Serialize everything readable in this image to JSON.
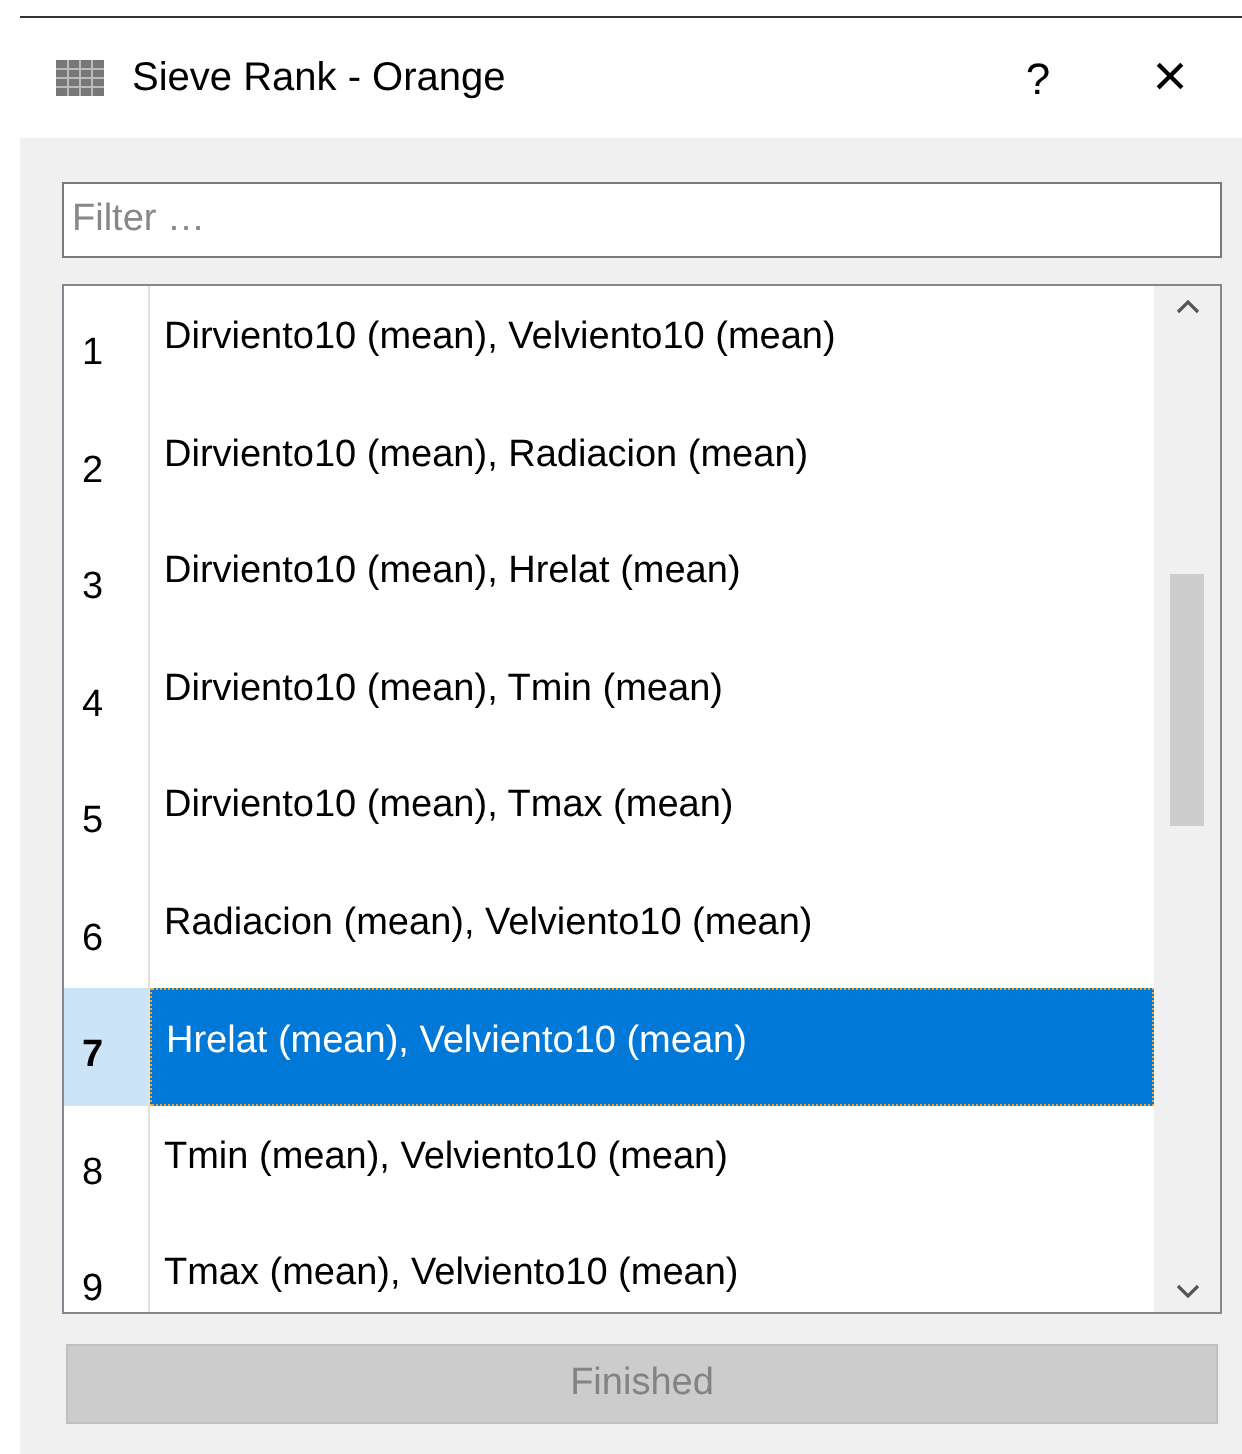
{
  "window": {
    "title": "Sieve Rank - Orange",
    "help": "?",
    "close": "×"
  },
  "filter": {
    "placeholder": "Filter …"
  },
  "rows": [
    {
      "index": "1",
      "label": "Dirviento10 (mean), Velviento10 (mean)",
      "selected": false
    },
    {
      "index": "2",
      "label": "Dirviento10 (mean), Radiacion (mean)",
      "selected": false
    },
    {
      "index": "3",
      "label": "Dirviento10 (mean), Hrelat (mean)",
      "selected": false
    },
    {
      "index": "4",
      "label": "Dirviento10 (mean), Tmin (mean)",
      "selected": false
    },
    {
      "index": "5",
      "label": "Dirviento10 (mean), Tmax (mean)",
      "selected": false
    },
    {
      "index": "6",
      "label": "Radiacion (mean), Velviento10 (mean)",
      "selected": false
    },
    {
      "index": "7",
      "label": "Hrelat (mean), Velviento10 (mean)",
      "selected": true
    },
    {
      "index": "8",
      "label": "Tmin (mean), Velviento10 (mean)",
      "selected": false
    },
    {
      "index": "9",
      "label": "Tmax (mean), Velviento10 (mean)",
      "selected": false
    }
  ],
  "button": {
    "label": "Finished",
    "disabled": true
  }
}
